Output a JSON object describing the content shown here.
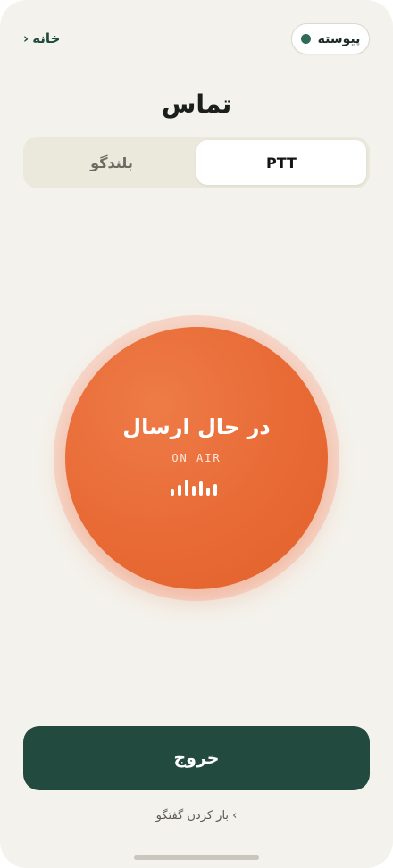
{
  "header": {
    "status_label": "پیوسته",
    "status_color": "#2f6a55",
    "home_label": "خانه",
    "home_chevron": "‹"
  },
  "page": {
    "title": "تماس"
  },
  "mode_tabs": [
    {
      "label": "PTT",
      "selected": true
    },
    {
      "label": "بلندگو",
      "selected": false
    }
  ],
  "ptt": {
    "state_label": "در حال ارسال",
    "sub_label": "ON AIR",
    "icon": "sound-wave-icon",
    "accent": "#e86a35"
  },
  "actions": {
    "exit_label": "خروج",
    "exit_color": "#224a3e",
    "chat_link": "› باز کردن گفتگو"
  }
}
